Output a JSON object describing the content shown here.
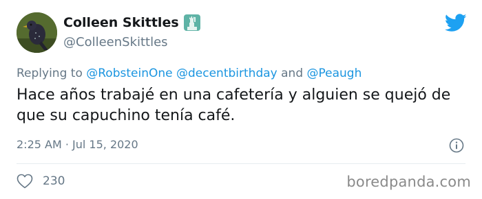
{
  "user": {
    "display_name": "Colleen Skittles",
    "handle": "@ColleenSkittles",
    "badge_icon": "statue-of-liberty-emoji-icon",
    "avatar_icon": "bird-avatar"
  },
  "header": {
    "logo_icon": "twitter-bird-icon",
    "logo_color": "#1da1f2"
  },
  "reply": {
    "prefix": "Replying to ",
    "mention1": "@RobsteinOne",
    "mention2": "@decentbirthday",
    "conjunction": " and ",
    "mention3": "@Peaugh",
    "mention_color": "#1b95e0"
  },
  "tweet": {
    "text": "Hace años trabajé en una cafetería y alguien se quejó de que su capuchino tenía café.",
    "timestamp": "2:25 AM · Jul 15, 2020"
  },
  "actions": {
    "like_icon": "heart-icon",
    "like_count": "230",
    "info_icon": "info-icon"
  },
  "watermark": {
    "text": "boredpanda.com"
  }
}
